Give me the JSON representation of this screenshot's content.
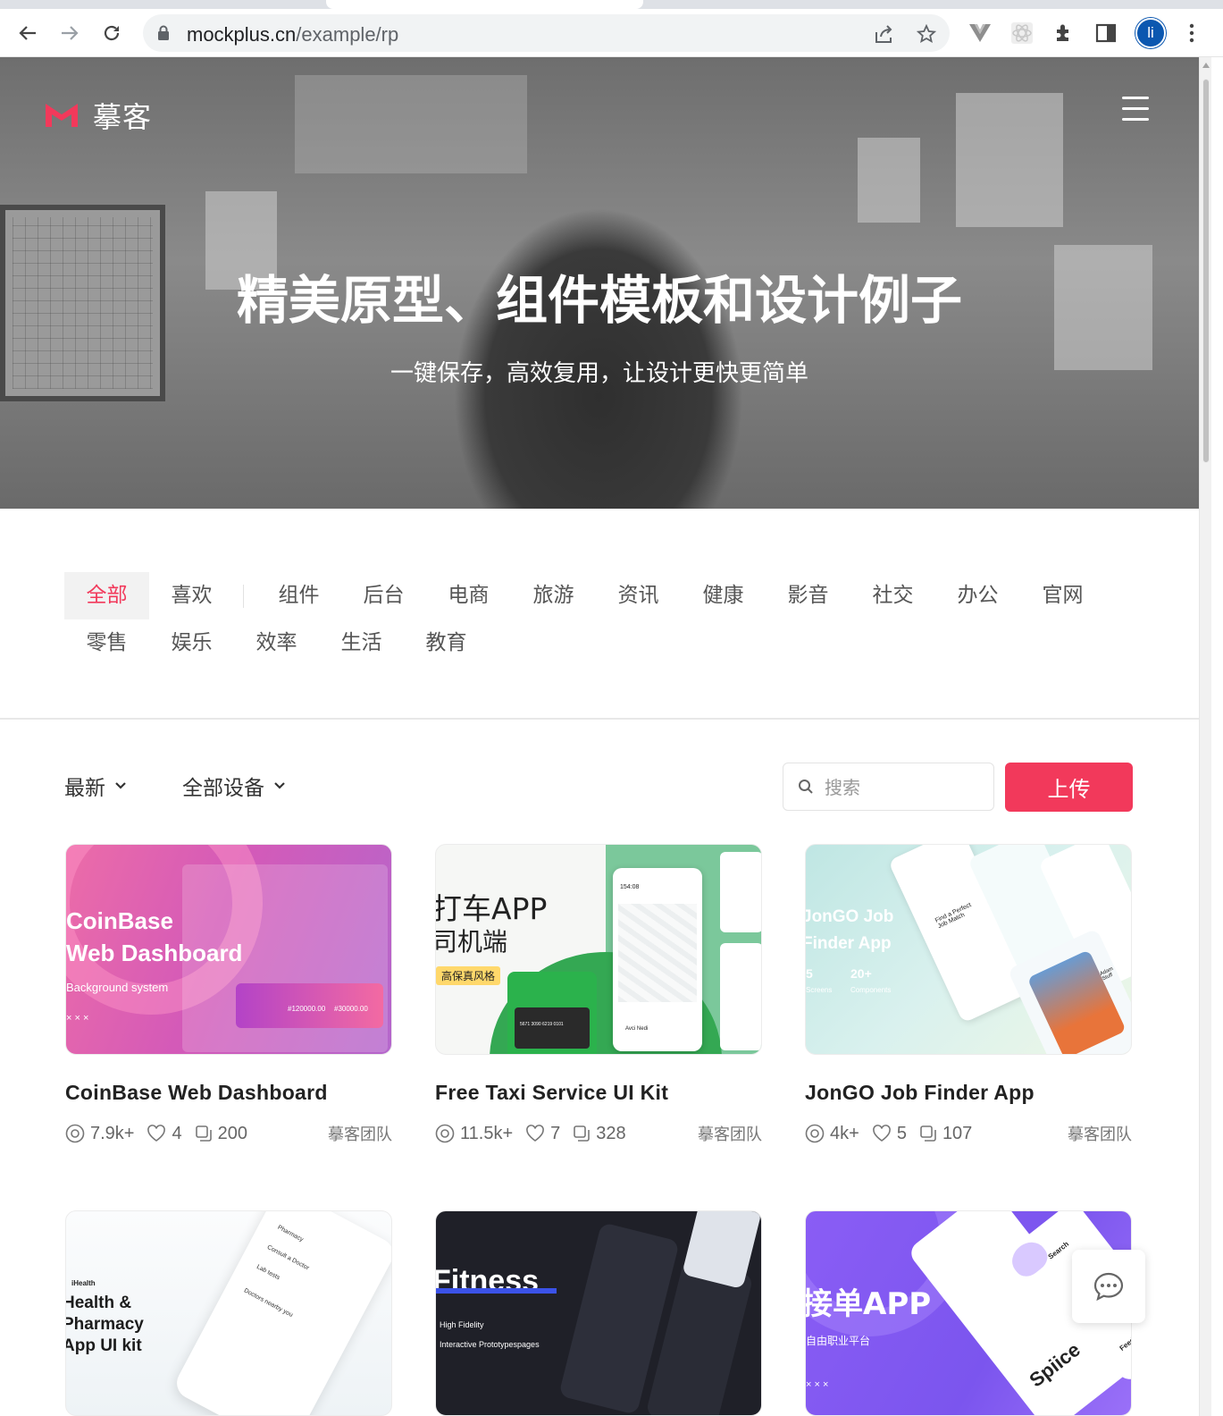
{
  "browser": {
    "url_host": "mockplus.cn",
    "url_path": "/example/rp",
    "profile_initial": "li"
  },
  "header": {
    "logo_text": "摹客",
    "brand_color": "#f2395b"
  },
  "hero": {
    "title": "精美原型、组件模板和设计例子",
    "subtitle": "一键保存，高效复用，让设计更快更简单"
  },
  "categories": {
    "items": [
      "全部",
      "喜欢",
      "组件",
      "后台",
      "电商",
      "旅游",
      "资讯",
      "健康",
      "影音",
      "社交",
      "办公",
      "官网",
      "零售",
      "娱乐",
      "效率",
      "生活",
      "教育"
    ],
    "active": "全部"
  },
  "filters": {
    "sort_label": "最新",
    "device_label": "全部设备",
    "search_placeholder": "搜索",
    "upload_label": "上传"
  },
  "cards": [
    {
      "title": "CoinBase Web Dashboard",
      "views": "7.9k+",
      "likes": "4",
      "pages": "200",
      "author": "摹客团队",
      "thumb": {
        "line1": "CoinBase",
        "line2": "Web Dashboard",
        "tag": "Background system",
        "marks": "× × ×",
        "amount1": "#120000.00",
        "amount2": "#30000.00"
      }
    },
    {
      "title": "Free Taxi Service UI Kit",
      "views": "11.5k+",
      "likes": "7",
      "pages": "328",
      "author": "摹客团队",
      "thumb": {
        "line1": "打车APP",
        "line2": "司机端",
        "tag": "高保真风格",
        "time": "154:08",
        "card_number": "5671  3090  6219  0101",
        "driver": "Avci Nedi"
      }
    },
    {
      "title": "JonGO Job Finder App",
      "views": "4k+",
      "likes": "5",
      "pages": "107",
      "author": "摹客团队",
      "thumb": {
        "line1": "JonGO Job",
        "line2": "Finder App",
        "stat1": "5",
        "stat1_label": "Screens",
        "stat2": "20+",
        "stat2_label": "Components",
        "tagline": "Find a Perfect Job Match",
        "person": "Adam Stuff"
      }
    },
    {
      "title": "",
      "thumb": {
        "brand": "iHealth",
        "line1": "Health &",
        "line2": "Pharmacy",
        "line3": "App UI kit",
        "item1": "Pharmacy",
        "item2": "Consult a Doctor",
        "item3": "Lab tests",
        "item4": "Doctors nearby you"
      }
    },
    {
      "title": "",
      "thumb": {
        "line1": "Fitness",
        "line2": "High Fidelity",
        "line3": "Interactive Prototypespages"
      }
    },
    {
      "title": "",
      "thumb": {
        "line1": "接单APP",
        "line2": "自由职业平台",
        "marks": "× × ×",
        "brand": "Spiice",
        "chip1": "Search",
        "chip2": "Feed"
      }
    }
  ]
}
